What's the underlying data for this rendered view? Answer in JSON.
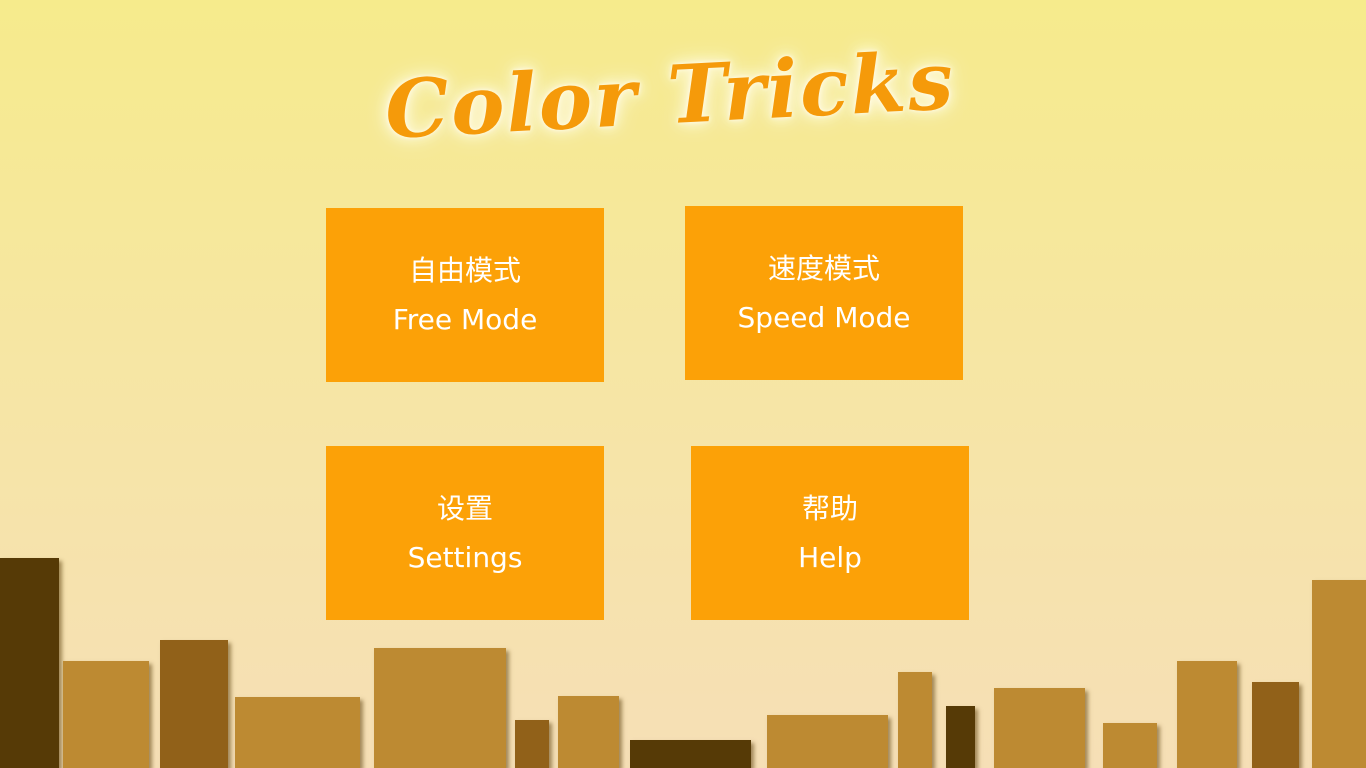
{
  "title": "Color Tricks",
  "menu": {
    "free_mode": {
      "label_zh": "自由模式",
      "label_en": "Free Mode"
    },
    "speed_mode": {
      "label_zh": "速度模式",
      "label_en": "Speed Mode"
    },
    "settings": {
      "label_zh": "设置",
      "label_en": "Settings"
    },
    "help": {
      "label_zh": "帮助",
      "label_en": "Help"
    }
  },
  "colors": {
    "title": "#f59a0a",
    "button_bg": "#fca107",
    "button_text": "#ffffff",
    "background_top": "#f6eb8c",
    "background_bottom": "#f6dfb6",
    "building_dark": "#563a06",
    "building_medium": "#916119",
    "building_light": "#bd8a32"
  }
}
